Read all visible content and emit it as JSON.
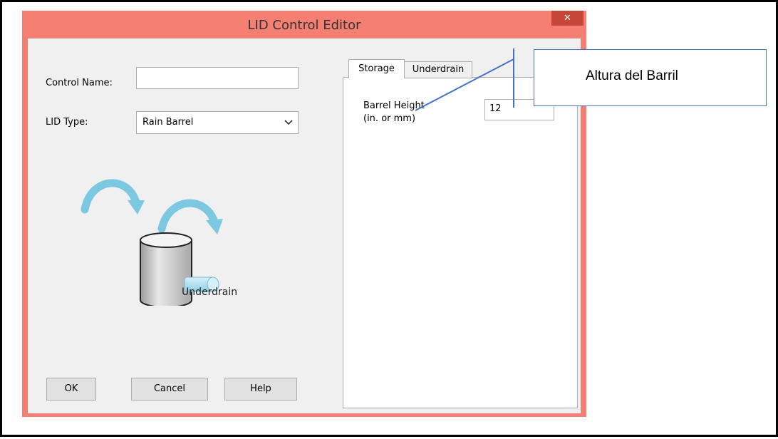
{
  "window": {
    "title": "LID Control Editor",
    "close_glyph": "✕"
  },
  "form": {
    "control_name_label": "Control Name:",
    "control_name_value": "",
    "lid_type_label": "LID Type:",
    "lid_type_value": "Rain Barrel",
    "illustration_label": "Underdrain"
  },
  "buttons": {
    "ok": "OK",
    "cancel": "Cancel",
    "help": "Help"
  },
  "tabs": [
    {
      "label": "Storage",
      "selected": true
    },
    {
      "label": "Underdrain",
      "selected": false
    }
  ],
  "storage": {
    "barrel_height_label_line1": "Barrel Height",
    "barrel_height_label_line2": "(in. or mm)",
    "barrel_height_value": "12"
  },
  "callout": {
    "text": "Altura del Barril"
  },
  "colors": {
    "window_frame": "#f47f72",
    "close_button": "#c8453a",
    "callout_border": "#4472c4",
    "barrel_arrow": "#7cc8e0"
  }
}
